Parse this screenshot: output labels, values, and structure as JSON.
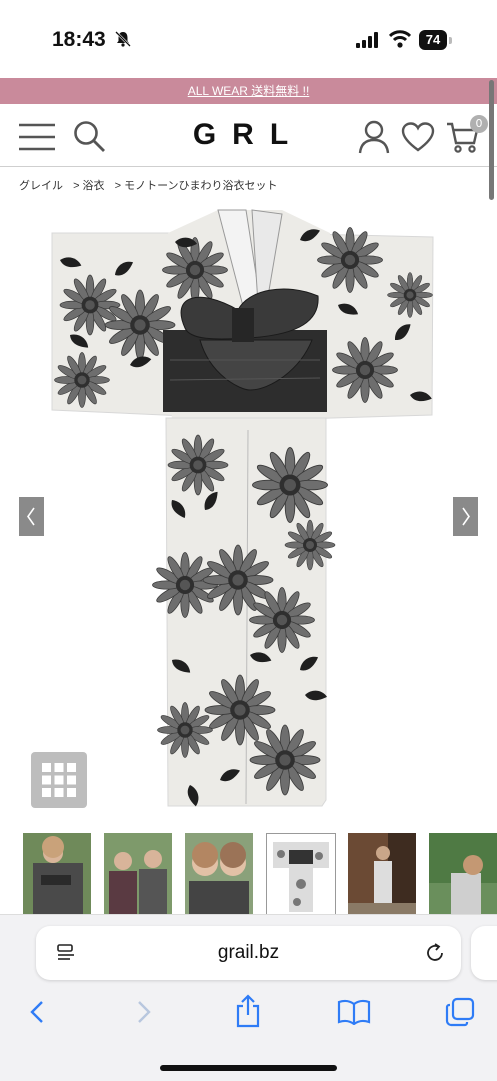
{
  "status_bar": {
    "time": "18:43",
    "battery": "74"
  },
  "promo": {
    "text": "ALL WEAR 送料無料 !!"
  },
  "header": {
    "logo": "GRL",
    "cart_count": "0"
  },
  "breadcrumb": {
    "items": [
      "グレイル",
      "> 浴衣",
      "> モノトーンひまわり浴衣セット"
    ]
  },
  "browser": {
    "url": "grail.bz"
  },
  "colors": {
    "promo_bg": "#c98a9b",
    "arrow_bg": "#8a8a8a"
  }
}
